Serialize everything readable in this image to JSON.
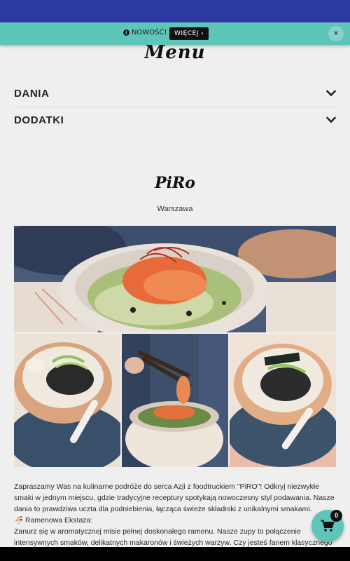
{
  "banner": {
    "text": "NOWOŚĆ!",
    "more_label": "WIĘCEJ ›",
    "close_label": "×",
    "color": "#5ec5b9"
  },
  "menu": {
    "title": "Menu",
    "categories": [
      {
        "label": "DANIA"
      },
      {
        "label": "DODATKI"
      }
    ]
  },
  "restaurant": {
    "name": "PiRo",
    "city": "Warszawa"
  },
  "description": {
    "intro": "Zapraszamy Was na kulinarne podróże do serca Azji z foodtruckiem \"PiRO\"! Odkryj niezwykłe smaki w jednym miejscu, gdzie tradycyjne receptury spotykają nowoczesny styl podawania. Nasze dania to prawdziwa uczta dla podniebienia, łącząca świeże składniki z unikalnymi smakami.",
    "section_title": "🍜 Ramenowa Ekstaza:",
    "section_text": "Zanurz się w aromatycznej misie pełnej doskonałego ramenu. Nasze zupy to połączenie intensywnych smaków, delikatnych makaronów i świeżych warzyw. Czy jesteś fanem klasycznego"
  },
  "cart": {
    "count": "0",
    "icon": "cart-icon"
  },
  "colors": {
    "topbar": "#2e3aa3",
    "accent": "#5ec5b9"
  }
}
